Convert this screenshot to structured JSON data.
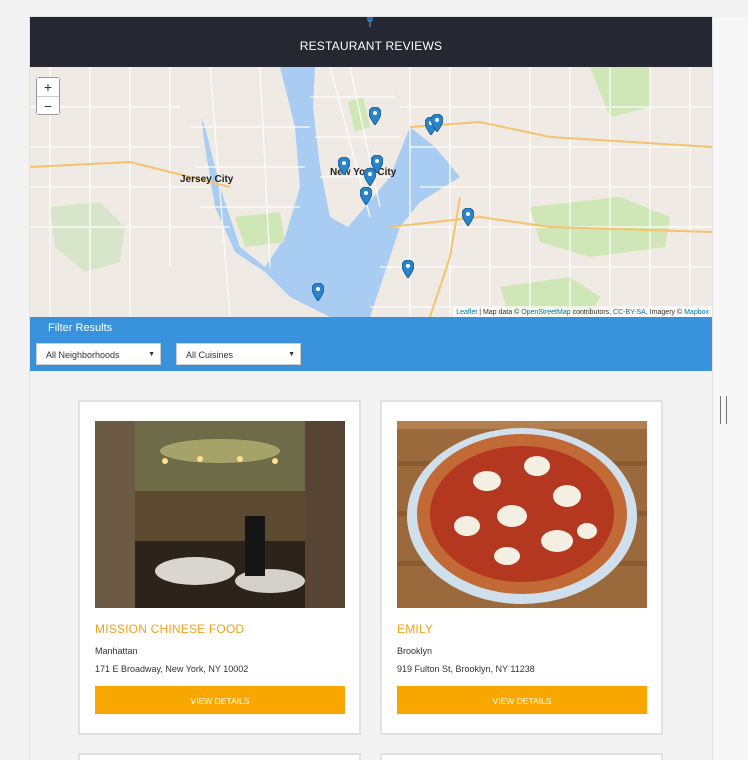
{
  "header": {
    "title": "RESTAURANT REVIEWS",
    "icon": "fork-knife-icon"
  },
  "map": {
    "zoom_in": "+",
    "zoom_out": "−",
    "labels": [
      "Jersey City",
      "New York City"
    ],
    "attribution": {
      "leaflet": "Leaflet",
      "prefix": " | Map data © ",
      "osm": "OpenStreetMap",
      "middle": " contributors, ",
      "license": "CC-BY-SA",
      "imagery": ", Imagery © ",
      "provider": "Mapbox"
    },
    "markers_count": 10,
    "colors": {
      "water": "#a9cdf2",
      "land": "#efeae3",
      "park": "#cfe6b6",
      "marker": "#2b84cb"
    }
  },
  "filter": {
    "label": "Filter Results",
    "neighborhood": "All Neighborhoods",
    "cuisine": "All Cuisines"
  },
  "restaurants": [
    {
      "name": "MISSION CHINESE FOOD",
      "neighborhood": "Manhattan",
      "address": "171 E Broadway, New York, NY 10002",
      "button": "VIEW DETAILS"
    },
    {
      "name": "EMILY",
      "neighborhood": "Brooklyn",
      "address": "919 Fulton St, Brooklyn, NY 11238",
      "button": "VIEW DETAILS"
    }
  ],
  "colors": {
    "accent": "#f7a700",
    "header_bg": "#252831",
    "filter_bg": "#3892dc",
    "name": "#f1a11b"
  }
}
